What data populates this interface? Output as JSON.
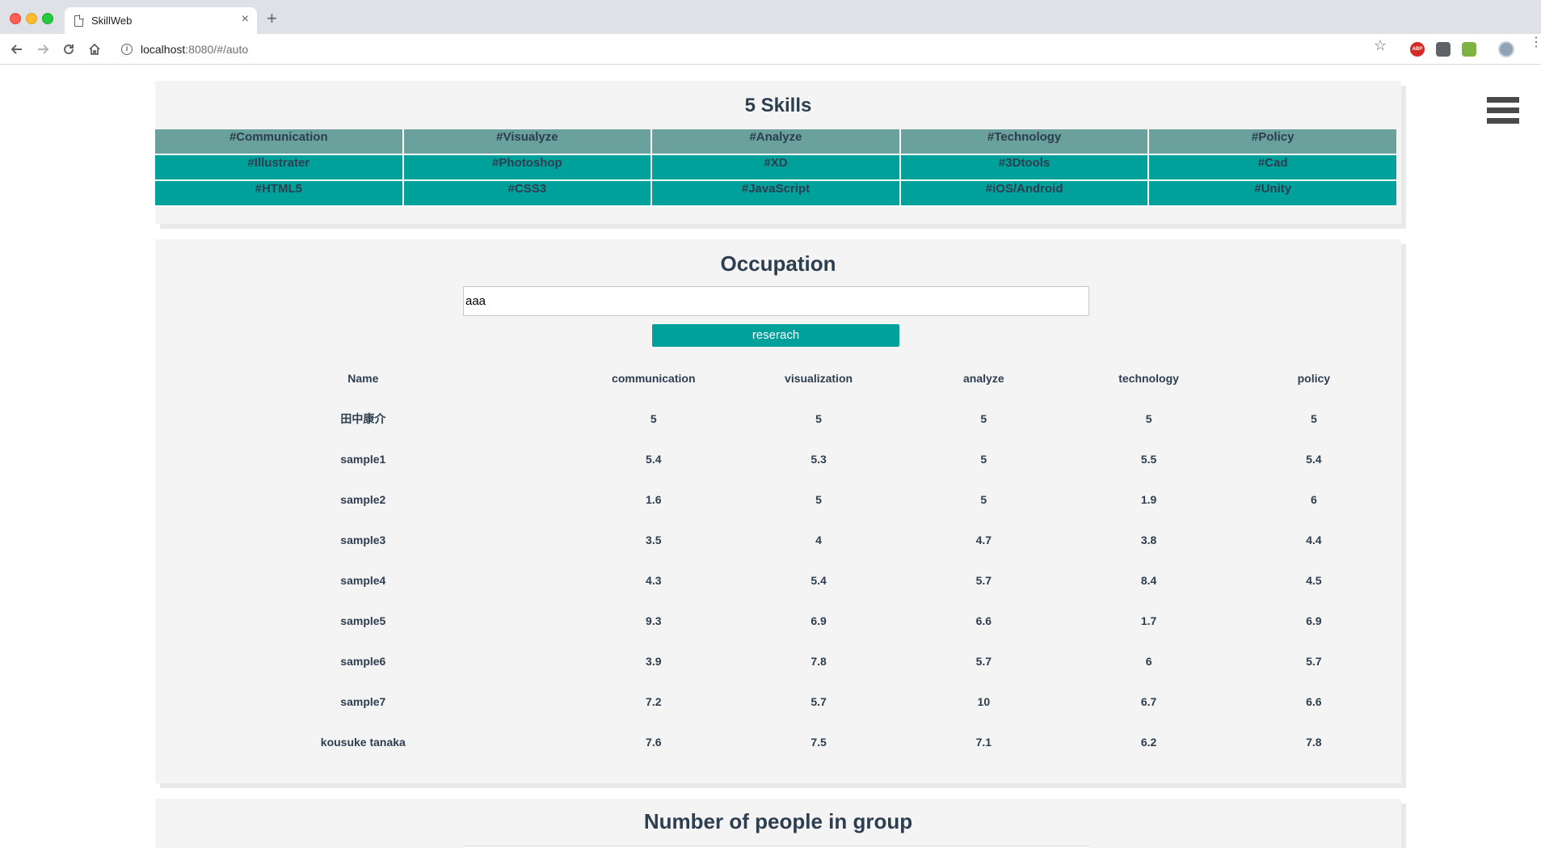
{
  "browser": {
    "tab_title": "SkillWeb",
    "tab_close": "×",
    "new_tab": "+",
    "url_host": "localhost",
    "url_path": ":8080/#/auto"
  },
  "icons": {
    "back": "arrow-left-icon",
    "forward": "arrow-right-icon",
    "reload": "reload-icon",
    "home": "home-icon",
    "star": "star-icon",
    "menu": "hamburger-menu-icon"
  },
  "colors": {
    "accent_teal": "#00a19b",
    "header_teal": "#6aa19c",
    "text_navy": "#2c3e50",
    "card_bg": "#f4f4f4"
  },
  "skills": {
    "title": "5 Skills",
    "header_row": [
      "#Communication",
      "#Visualyze",
      "#Analyze",
      "#Technology",
      "#Policy"
    ],
    "rows": [
      [
        "#Illustrater",
        "#Photoshop",
        "#XD",
        "#3Dtools",
        "#Cad"
      ],
      [
        "#HTML5",
        "#CSS3",
        "#JavaScript",
        "#iOS/Android",
        "#Unity"
      ]
    ]
  },
  "occupation": {
    "title": "Occupation",
    "search_value": "aaa",
    "button_label": "reserach",
    "columns": [
      "Name",
      "communication",
      "visualization",
      "analyze",
      "technology",
      "policy"
    ],
    "rows": [
      [
        "田中康介",
        "5",
        "5",
        "5",
        "5",
        "5"
      ],
      [
        "sample1",
        "5.4",
        "5.3",
        "5",
        "5.5",
        "5.4"
      ],
      [
        "sample2",
        "1.6",
        "5",
        "5",
        "1.9",
        "6"
      ],
      [
        "sample3",
        "3.5",
        "4",
        "4.7",
        "3.8",
        "4.4"
      ],
      [
        "sample4",
        "4.3",
        "5.4",
        "5.7",
        "8.4",
        "4.5"
      ],
      [
        "sample5",
        "9.3",
        "6.9",
        "6.6",
        "1.7",
        "6.9"
      ],
      [
        "sample6",
        "3.9",
        "7.8",
        "5.7",
        "6",
        "5.7"
      ],
      [
        "sample7",
        "7.2",
        "5.7",
        "10",
        "6.7",
        "6.6"
      ],
      [
        "kousuke tanaka",
        "7.6",
        "7.5",
        "7.1",
        "6.2",
        "7.8"
      ]
    ]
  },
  "group": {
    "title": "Number of people in group"
  }
}
